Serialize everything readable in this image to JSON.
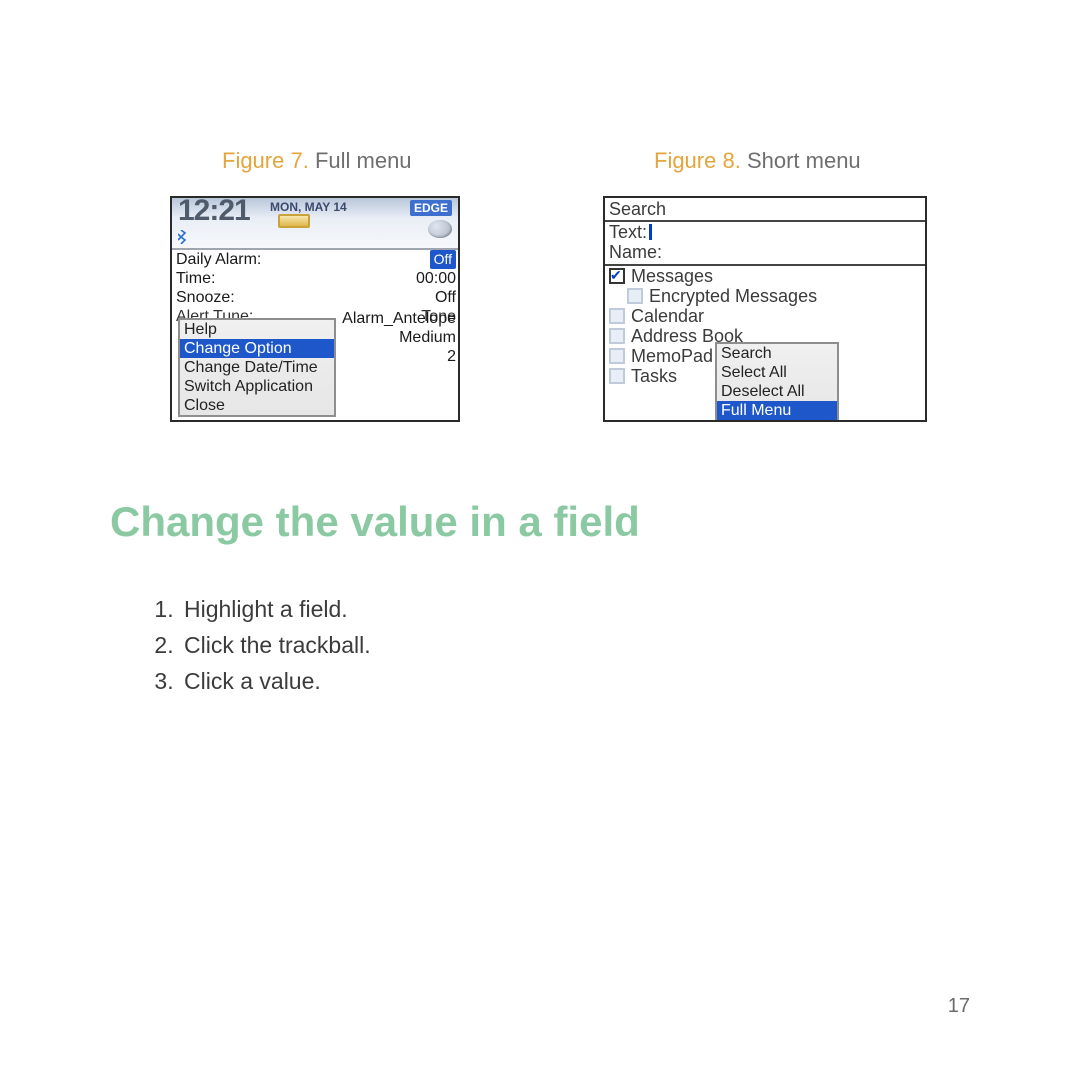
{
  "captions": {
    "fig7": {
      "ref": "Figure 7.",
      "text": " Full menu"
    },
    "fig8": {
      "ref": "Figure 8.",
      "text": " Short menu"
    }
  },
  "fig7": {
    "clock": "12:21",
    "date": "MON, MAY 14",
    "network": "EDGE",
    "bt_icon": "bluetooth-icon",
    "speaker_icon": "speaker-icon",
    "rows": {
      "daily_alarm": {
        "label": "Daily Alarm:",
        "value": "Off"
      },
      "time": {
        "label": "Time:",
        "value": "00:00"
      },
      "snooze": {
        "label": "Snooze:",
        "value": "Off"
      },
      "alert_tune": {
        "label": "Alert Tune:",
        "value": "Tone"
      }
    },
    "right_values": {
      "tune": "Alarm_Antelope",
      "volume": "Medium",
      "count": "2"
    },
    "menu": {
      "items": [
        {
          "label": "Help"
        },
        {
          "label": "Change Option"
        },
        {
          "label": "Change Date/Time"
        },
        {
          "label": "Switch Application"
        },
        {
          "label": "Close"
        }
      ],
      "selected_index": 1
    }
  },
  "fig8": {
    "title": "Search",
    "fields": {
      "text_label": "Text:",
      "name_label": "Name:"
    },
    "list": [
      {
        "label": "Messages",
        "checked": true,
        "indent": false
      },
      {
        "label": "Encrypted Messages",
        "checked": false,
        "indent": true
      },
      {
        "label": "Calendar",
        "checked": false,
        "indent": false
      },
      {
        "label": "Address Book",
        "checked": false,
        "indent": false
      },
      {
        "label": "MemoPad",
        "checked": false,
        "indent": false
      },
      {
        "label": "Tasks",
        "checked": false,
        "indent": false
      }
    ],
    "short_menu": {
      "items": [
        {
          "label": "Search"
        },
        {
          "label": "Select All"
        },
        {
          "label": "Deselect All"
        },
        {
          "label": "Full Menu"
        }
      ],
      "selected_index": 3
    }
  },
  "section_heading": "Change the value in a field",
  "steps": [
    "Highlight a field.",
    "Click the trackball.",
    "Click a value."
  ],
  "page_number": "17"
}
